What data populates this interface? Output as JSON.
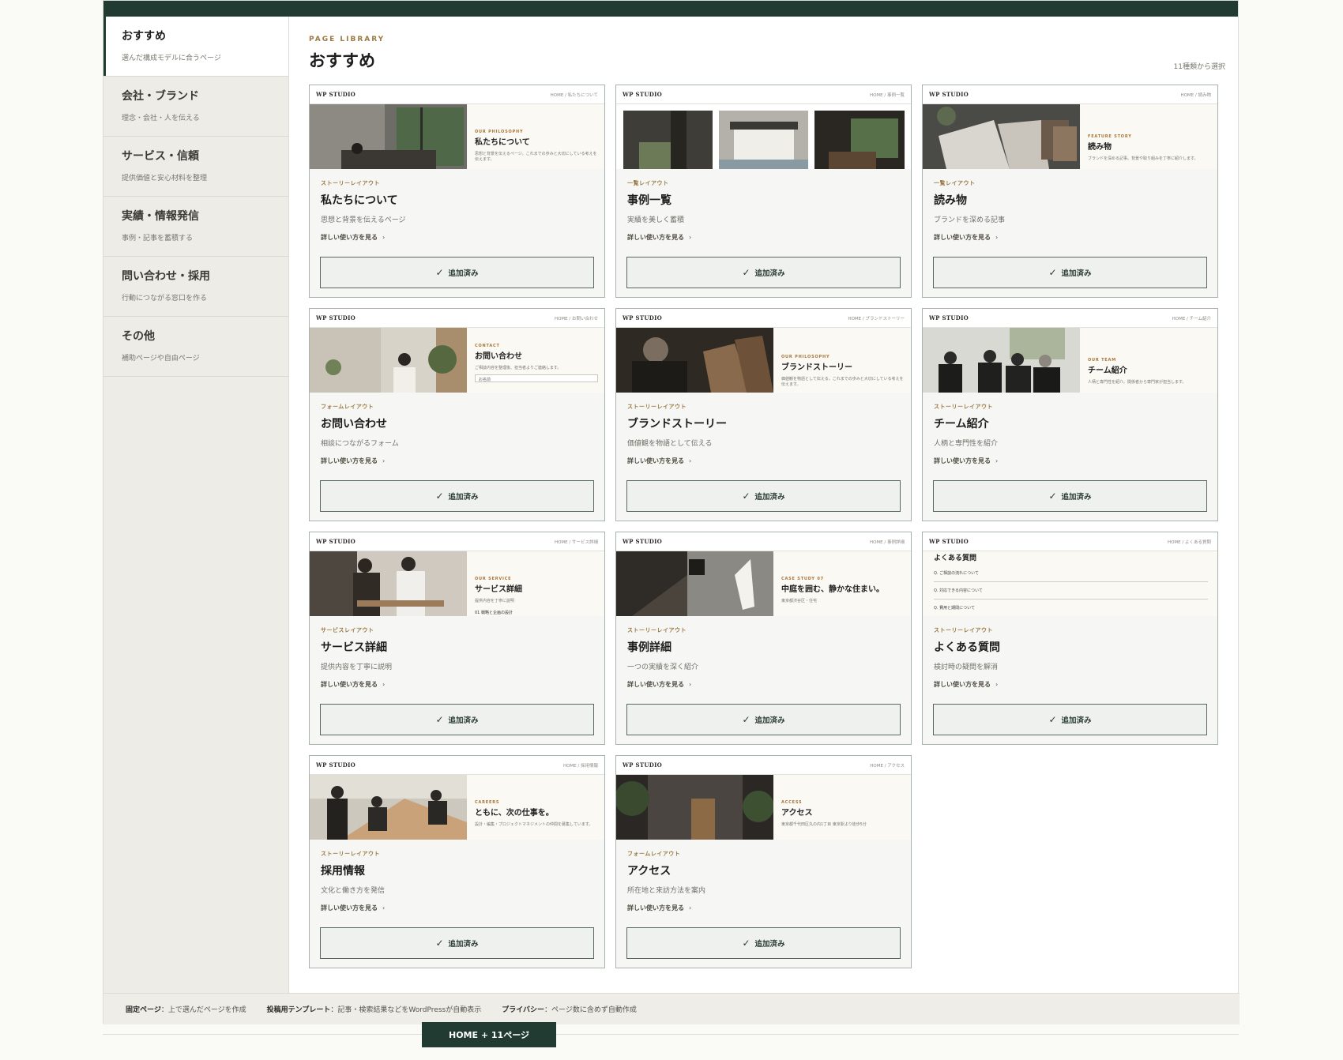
{
  "sidebar": {
    "items": [
      {
        "title": "おすすめ",
        "desc": "選んだ構成モデルに合うページ"
      },
      {
        "title": "会社・ブランド",
        "desc": "理念・会社・人を伝える"
      },
      {
        "title": "サービス・信頼",
        "desc": "提供価値と安心材料を整理"
      },
      {
        "title": "実績・情報発信",
        "desc": "事例・記事を蓄積する"
      },
      {
        "title": "問い合わせ・採用",
        "desc": "行動につながる窓口を作る"
      },
      {
        "title": "その他",
        "desc": "補助ページや自由ページ"
      }
    ]
  },
  "header": {
    "eyebrow": "PAGE LIBRARY",
    "title": "おすすめ",
    "count": "11種類から選択"
  },
  "common": {
    "brand": "WP STUDIO",
    "detail": "詳しい使い方を見る",
    "added": "追加済み"
  },
  "cards": [
    {
      "crumb": "HOME / 私たちについて",
      "pk": "OUR PHILOSOPHY",
      "ph": "私たちについて",
      "ps": "思想と背景を伝えるページ。これまでの歩みと大切にしている考えを伝えます。",
      "tag": "ストーリーレイアウト",
      "title": "私たちについて",
      "desc": "思想と背景を伝えるページ"
    },
    {
      "crumb": "HOME / 事例一覧",
      "tag": "一覧レイアウト",
      "title": "事例一覧",
      "desc": "実績を美しく蓄積"
    },
    {
      "crumb": "HOME / 読み物",
      "pk": "FEATURE STORY",
      "ph": "読み物",
      "ps": "ブランドを深める記事。背景や取り組みを丁寧に紹介します。",
      "tag": "一覧レイアウト",
      "title": "読み物",
      "desc": "ブランドを深める記事"
    },
    {
      "crumb": "HOME / お問い合わせ",
      "pk": "CONTACT",
      "ph": "お問い合わせ",
      "ps": "ご相談内容を整理後、担当者よりご連絡します。",
      "field": "お名前",
      "tag": "フォームレイアウト",
      "title": "お問い合わせ",
      "desc": "相談につながるフォーム"
    },
    {
      "crumb": "HOME / ブランドストーリー",
      "pk": "OUR PHILOSOPHY",
      "ph": "ブランドストーリー",
      "ps": "価値観を物語として伝える。これまでの歩みと大切にしている考えを伝えます。",
      "tag": "ストーリーレイアウト",
      "title": "ブランドストーリー",
      "desc": "価値観を物語として伝える"
    },
    {
      "crumb": "HOME / チーム紹介",
      "pk": "OUR TEAM",
      "ph": "チーム紹介",
      "ps": "人柄と専門性を紹介。関係者から専門家が担当します。",
      "tag": "ストーリーレイアウト",
      "title": "チーム紹介",
      "desc": "人柄と専門性を紹介"
    },
    {
      "crumb": "HOME / サービス詳細",
      "pk": "OUR SERVICE",
      "ph": "サービス詳細",
      "ps": "提供内容を丁寧に説明",
      "item": "01 戦略と企画の設計",
      "tag": "サービスレイアウト",
      "title": "サービス詳細",
      "desc": "提供内容を丁寧に説明"
    },
    {
      "crumb": "HOME / 事例詳細",
      "pk": "CASE STUDY 07",
      "ph": "中庭を囲む、静かな住まい。",
      "ps": "東京都渋谷区・住宅",
      "tag": "ストーリーレイアウト",
      "title": "事例詳細",
      "desc": "一つの実績を深く紹介"
    },
    {
      "crumb": "HOME / よくある質問",
      "faq_title": "よくある質問",
      "faq": [
        "Q. ご相談の流れについて",
        "Q. 対応できる内容について",
        "Q. 費用と期間について"
      ],
      "tag": "ストーリーレイアウト",
      "title": "よくある質問",
      "desc": "検討時の疑問を解消"
    },
    {
      "crumb": "HOME / 採用情報",
      "pk": "CAREERS",
      "ph": "ともに、次の仕事を。",
      "ps": "設計・編集・プロジェクトマネジメントの仲間を募集しています。",
      "tag": "ストーリーレイアウト",
      "title": "採用情報",
      "desc": "文化と働き方を発信"
    },
    {
      "crumb": "HOME / アクセス",
      "pk": "ACCESS",
      "ph": "アクセス",
      "ps": "東京都千代田区丸の内1丁目 東京駅より徒歩5分",
      "tag": "フォームレイアウト",
      "title": "アクセス",
      "desc": "所在地と来訪方法を案内"
    }
  ],
  "footer": {
    "items": [
      {
        "label": "固定ページ",
        "text": "：上で選んだページを作成"
      },
      {
        "label": "投稿用テンプレート",
        "text": "：記事・検索結果などをWordPressが自動表示"
      },
      {
        "label": "プライバシー",
        "text": "：ページ数に含めず自動作成"
      }
    ]
  },
  "cta": {
    "label": "HOME + 11ページ"
  }
}
